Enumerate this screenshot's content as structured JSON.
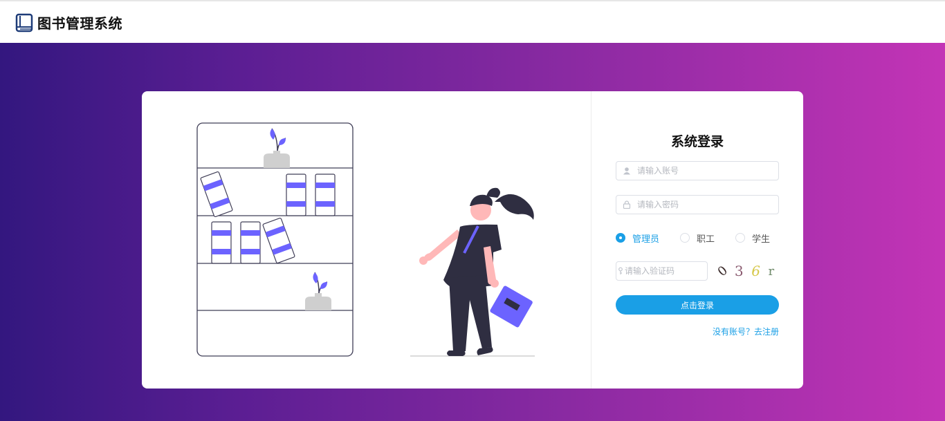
{
  "app": {
    "title": "图书管理系统",
    "logo_icon": "book-icon"
  },
  "login": {
    "title": "系统登录",
    "username_placeholder": "请输入账号",
    "password_placeholder": "请输入密码",
    "code_placeholder": "请输入验证码",
    "roles": [
      {
        "label": "管理员",
        "selected": true
      },
      {
        "label": "职工",
        "selected": false
      },
      {
        "label": "学生",
        "selected": false
      }
    ],
    "captcha": [
      "0",
      "3",
      "6",
      "r"
    ],
    "submit_label": "点击登录",
    "register_link": "没有账号？去注册"
  },
  "colors": {
    "accent": "#1a9fe6",
    "gradient_start": "#33177f",
    "gradient_end": "#c334b6",
    "illustration_purple": "#6c63ff",
    "illustration_dark": "#2f2e41"
  }
}
